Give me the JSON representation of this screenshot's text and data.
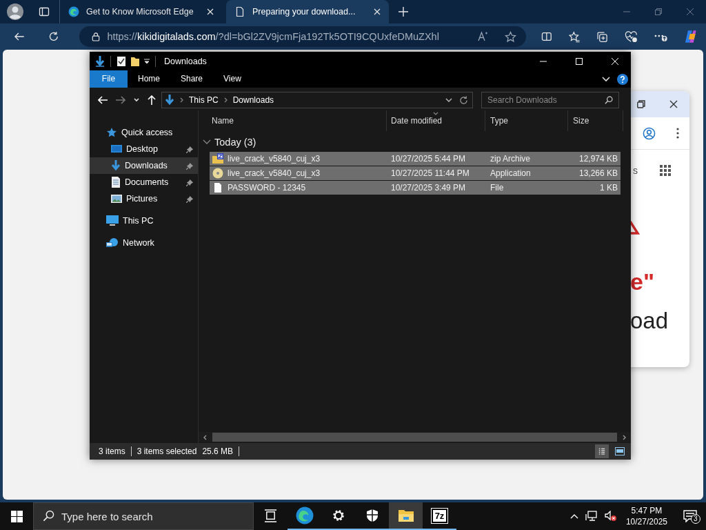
{
  "browser": {
    "tabs": [
      {
        "title": "Get to Know Microsoft Edge",
        "kind": "edge",
        "selected": false
      },
      {
        "title": "Preparing your download...",
        "kind": "page",
        "selected": true
      }
    ],
    "address": {
      "scheme": "https://",
      "host": "kikidigitalads.com",
      "path": "/?dl=bGl2ZV9jcmFja192Tk5OTI9CQUxfeDMuZXhl"
    }
  },
  "page_behind": {
    "texts": [
      {
        "kind": "label",
        "text": "s"
      },
      {
        "kind": "accent",
        "text": "e\""
      },
      {
        "kind": "heading",
        "text": "oad"
      }
    ]
  },
  "explorer": {
    "title": "Downloads",
    "ribbon_tabs": [
      {
        "label": "File",
        "selected": true
      },
      {
        "label": "Home",
        "selected": false
      },
      {
        "label": "Share",
        "selected": false
      },
      {
        "label": "View",
        "selected": false
      }
    ],
    "breadcrumb": [
      "This PC",
      "Downloads"
    ],
    "search": {
      "placeholder": "Search Downloads"
    },
    "nav": [
      {
        "label": "Quick access",
        "kind": "star",
        "selected": false,
        "pinned": false,
        "children": [
          {
            "label": "Desktop",
            "kind": "desktop",
            "selected": false,
            "pinned": true
          },
          {
            "label": "Downloads",
            "kind": "downloads",
            "selected": true,
            "pinned": true
          },
          {
            "label": "Documents",
            "kind": "documents",
            "selected": false,
            "pinned": true
          },
          {
            "label": "Pictures",
            "kind": "pictures",
            "selected": false,
            "pinned": true
          }
        ]
      },
      {
        "label": "This PC",
        "kind": "pc",
        "selected": false,
        "pinned": false
      },
      {
        "label": "Network",
        "kind": "network",
        "selected": false,
        "pinned": false
      }
    ],
    "columns": [
      "Name",
      "Date modified",
      "Type",
      "Size"
    ],
    "group": {
      "label": "Today (3)",
      "expanded": true
    },
    "files": [
      {
        "name": "live_crack_v5840_cuj_x3",
        "date": "10/27/2025 5:44 PM",
        "type": "zip Archive",
        "size": "12,974 KB",
        "kind": "zip",
        "selected": true
      },
      {
        "name": "live_crack_v5840_cuj_x3",
        "date": "10/27/2025 11:44 PM",
        "type": "Application",
        "size": "13,266 KB",
        "kind": "app",
        "selected": true
      },
      {
        "name": "PASSWORD - 12345",
        "date": "10/27/2025 3:49 PM",
        "type": "File",
        "size": "1 KB",
        "kind": "file",
        "selected": true
      }
    ],
    "status": {
      "count": "3 items",
      "selection": "3 items selected",
      "size": "25.6 MB"
    },
    "views": [
      {
        "kind": "details",
        "selected": true
      },
      {
        "kind": "tiles",
        "selected": false
      }
    ]
  },
  "taskbar": {
    "search": {
      "placeholder": "Type here to search"
    },
    "apps": [
      {
        "kind": "taskview",
        "running": false,
        "selected": false
      },
      {
        "kind": "edge",
        "running": true,
        "selected": false
      },
      {
        "kind": "settings",
        "running": true,
        "selected": false
      },
      {
        "kind": "security",
        "running": true,
        "selected": false
      },
      {
        "kind": "explorer",
        "running": true,
        "selected": true
      },
      {
        "kind": "archiver",
        "label": "7z",
        "running": true,
        "selected": false
      }
    ],
    "time": "5:47 PM",
    "date": "10/27/2025",
    "notifications": "3"
  }
}
